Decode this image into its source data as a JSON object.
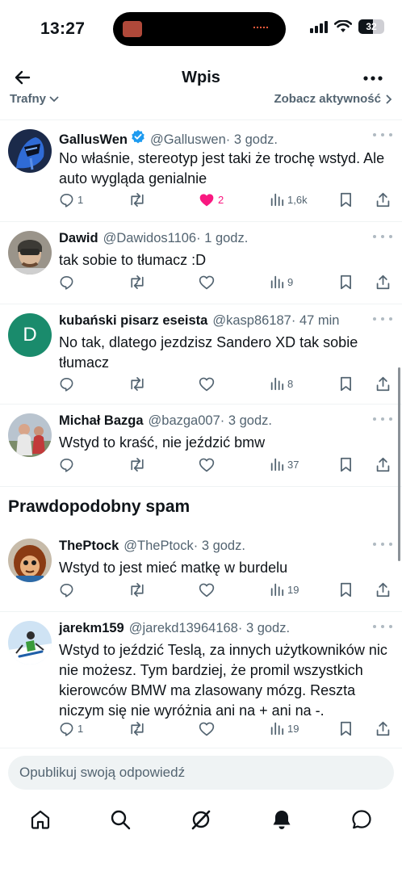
{
  "status": {
    "time": "13:27",
    "battery": "32",
    "signal_icon": "cellular-signal-icon",
    "wifi_icon": "wifi-icon"
  },
  "header": {
    "title": "Wpis",
    "back_icon": "back-arrow-icon",
    "more_icon": "more-horizontal-icon"
  },
  "subbar": {
    "sort_label": "Trafny",
    "activity_label": "Zobacz aktywność"
  },
  "tweets": [
    {
      "name": "GallusWen",
      "verified": true,
      "handle": "@Galluswen",
      "time": "· 3 godz.",
      "text": "No właśnie, stereotyp jest taki że trochę wstyd. Ale auto wygląda genialnie",
      "replies": "1",
      "retweets": "",
      "likes": "2",
      "liked": true,
      "views": "1,6k"
    },
    {
      "name": "Dawid",
      "verified": false,
      "handle": "@Dawidos1106",
      "time": "· 1 godz.",
      "text": "tak sobie to tłumacz :D",
      "replies": "",
      "retweets": "",
      "likes": "",
      "liked": false,
      "views": "9"
    },
    {
      "name": "kubański pisarz eseista",
      "verified": false,
      "handle": "@kasp86187",
      "time": "· 47 min",
      "avatar_letter": "D",
      "text": "No tak, dlatego jezdzisz Sandero XD tak sobie tłumacz",
      "replies": "",
      "retweets": "",
      "likes": "",
      "liked": false,
      "views": "8"
    },
    {
      "name": "Michał Bazga",
      "verified": false,
      "handle": "@bazga007",
      "time": "· 3 godz.",
      "text": "Wstyd to kraść, nie jeździć bmw",
      "replies": "",
      "retweets": "",
      "likes": "",
      "liked": false,
      "views": "37"
    },
    {
      "name": "ThePtock",
      "verified": false,
      "handle": "@ThePtock",
      "time": "· 3 godz.",
      "text": "Wstyd to jest mieć matkę w burdelu",
      "replies": "",
      "retweets": "",
      "likes": "",
      "liked": false,
      "views": "19"
    },
    {
      "name": "jarekm159",
      "verified": false,
      "handle": "@jarekd13964168",
      "time": "· 3 godz.",
      "text": "Wstyd to jeździć Teslą, za innych użytkowników nic nie możesz. Tym bardziej, że promil wszystkich kierowców BMW ma zlasowany mózg. Reszta niczym się nie wyróżnia ani na + ani na -.",
      "replies": "1",
      "retweets": "",
      "likes": "",
      "liked": false,
      "views": "19"
    }
  ],
  "section": {
    "spam_title": "Prawdopodobny spam"
  },
  "reply": {
    "placeholder": "Opublikuj swoją odpowiedź"
  },
  "nav": {
    "items": [
      "home-icon",
      "search-icon",
      "grok-icon",
      "notifications-icon",
      "messages-icon"
    ]
  },
  "colors": {
    "like": "#f91880",
    "verified": "#1d9bf0",
    "muted": "#536471"
  }
}
